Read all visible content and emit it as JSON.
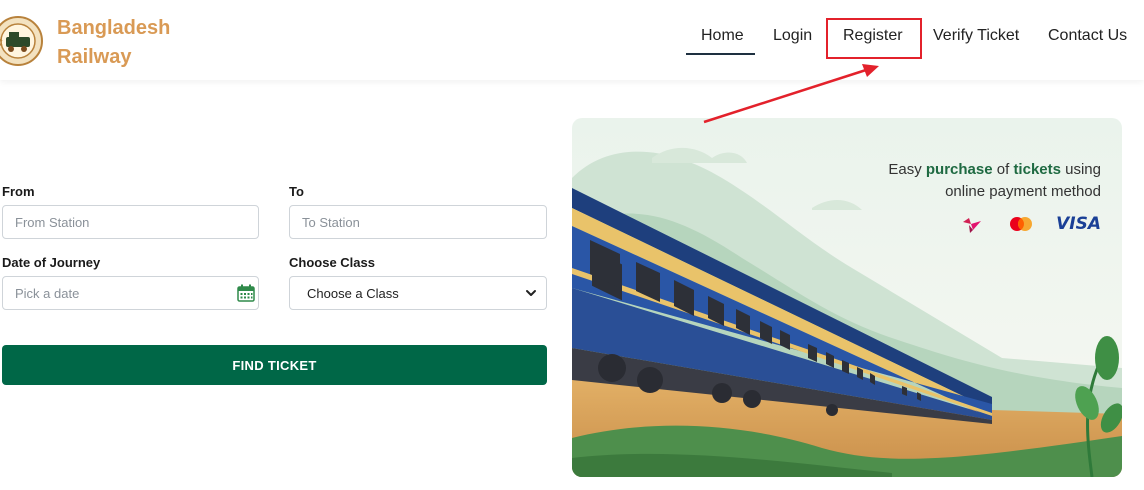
{
  "header": {
    "brand_line1": "Bangladesh",
    "brand_line2": "Railway",
    "logo_icon": "railway-emblem-icon"
  },
  "nav": {
    "items": [
      {
        "label": "Home",
        "active": true
      },
      {
        "label": "Login"
      },
      {
        "label": "Register",
        "highlighted": true
      },
      {
        "label": "Verify Ticket"
      },
      {
        "label": "Contact Us"
      }
    ]
  },
  "form": {
    "from_label": "From",
    "from_placeholder": "From Station",
    "to_label": "To",
    "to_placeholder": "To Station",
    "date_label": "Date of Journey",
    "date_placeholder": "Pick a date",
    "class_label": "Choose Class",
    "class_selected": "Choose a Class",
    "find_button": "FIND TICKET"
  },
  "banner": {
    "line1_pre": "Easy ",
    "line1_bold1": "purchase",
    "line1_mid": " of ",
    "line1_bold2": "tickets",
    "line1_post": " using",
    "line2": "online payment method",
    "payment_icons": [
      "bkash-icon",
      "mastercard-icon",
      "visa-icon"
    ],
    "visa_label": "VISA"
  },
  "colors": {
    "accent": "#006747",
    "brand": "#d99a55",
    "highlight": "#e3212b"
  }
}
